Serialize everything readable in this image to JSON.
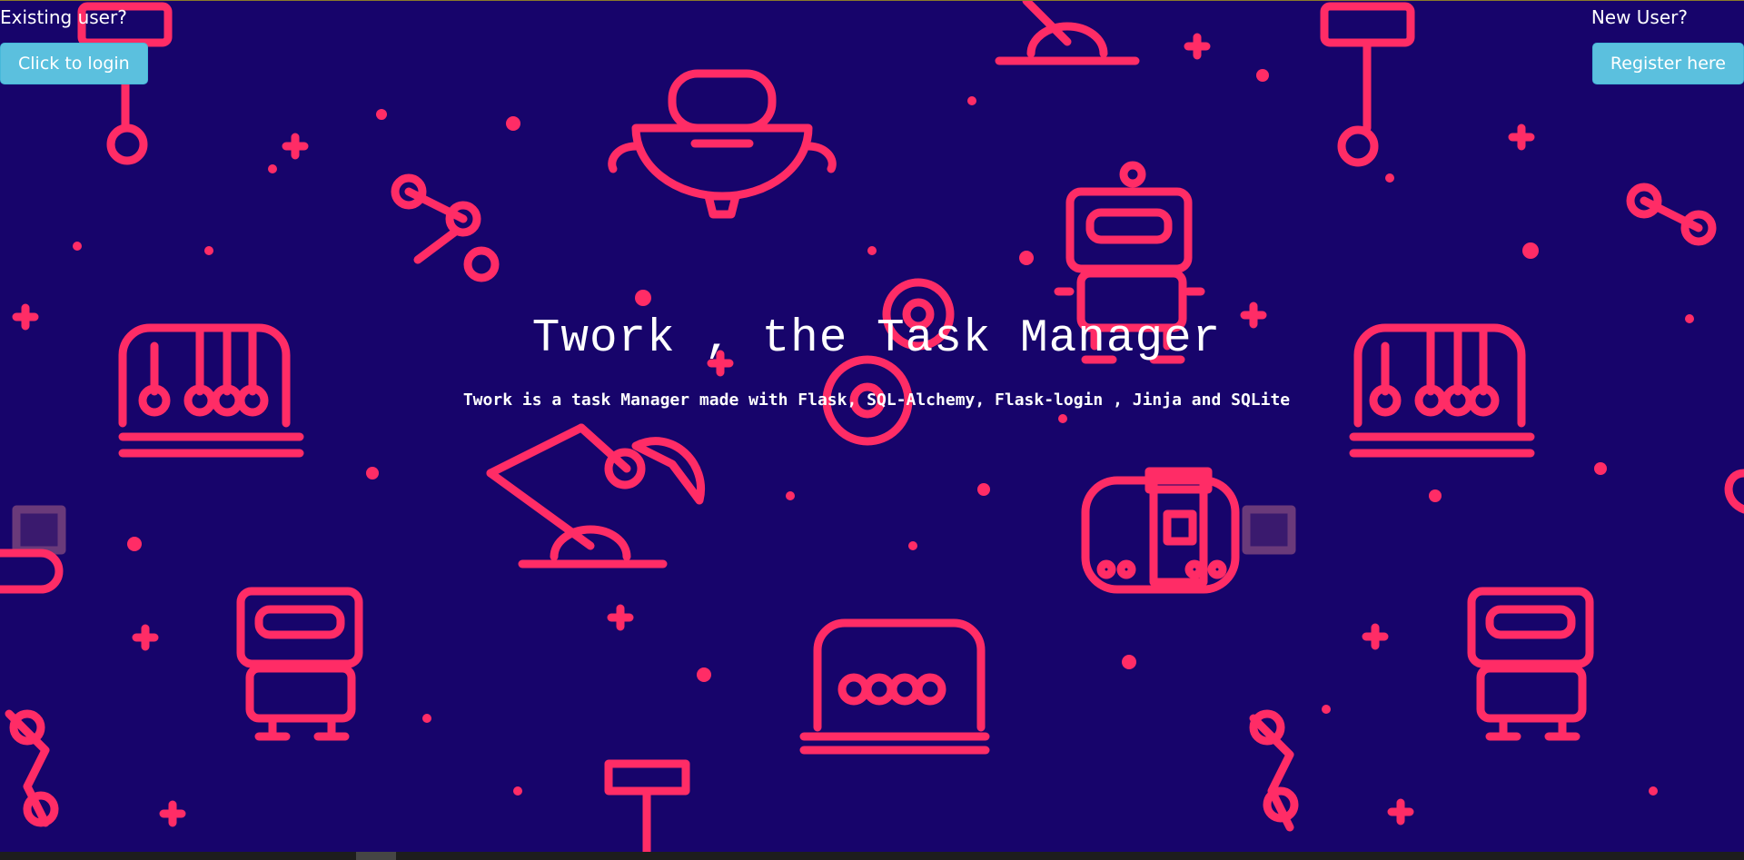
{
  "auth": {
    "existing_prompt": "Existing user?",
    "login_label": "Click to login",
    "new_prompt": "New User?",
    "register_label": "Register here"
  },
  "hero": {
    "title": "Twork , the Task Manager",
    "subtitle": "Twork is a task Manager made with Flask, SQL-Alchemy, Flask-login , Jinja and SQLite"
  },
  "theme": {
    "background": "#17046b",
    "pattern_color": "#ff2c66",
    "button_color": "#5bc0de"
  }
}
